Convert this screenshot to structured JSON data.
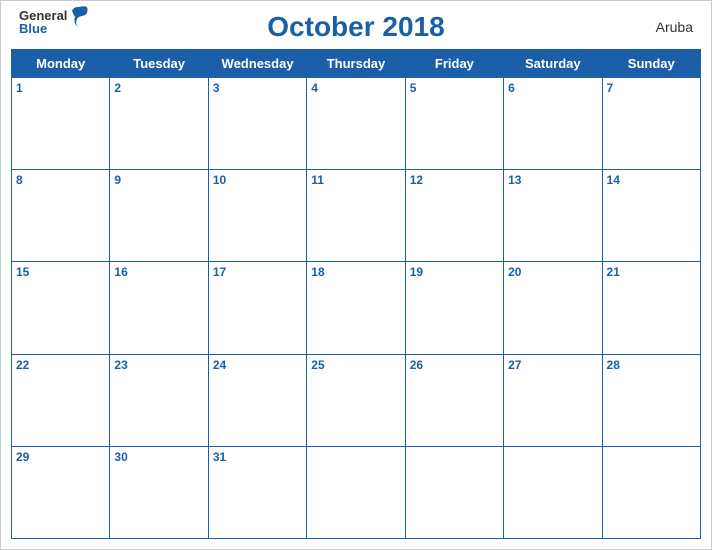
{
  "header": {
    "title": "October 2018",
    "country": "Aruba",
    "logo_general": "General",
    "logo_blue": "Blue"
  },
  "days_of_week": [
    "Monday",
    "Tuesday",
    "Wednesday",
    "Thursday",
    "Friday",
    "Saturday",
    "Sunday"
  ],
  "weeks": [
    [
      1,
      2,
      3,
      4,
      5,
      6,
      7
    ],
    [
      8,
      9,
      10,
      11,
      12,
      13,
      14
    ],
    [
      15,
      16,
      17,
      18,
      19,
      20,
      21
    ],
    [
      22,
      23,
      24,
      25,
      26,
      27,
      28
    ],
    [
      29,
      30,
      31,
      null,
      null,
      null,
      null
    ]
  ],
  "accent_color": "#1a5fa8"
}
